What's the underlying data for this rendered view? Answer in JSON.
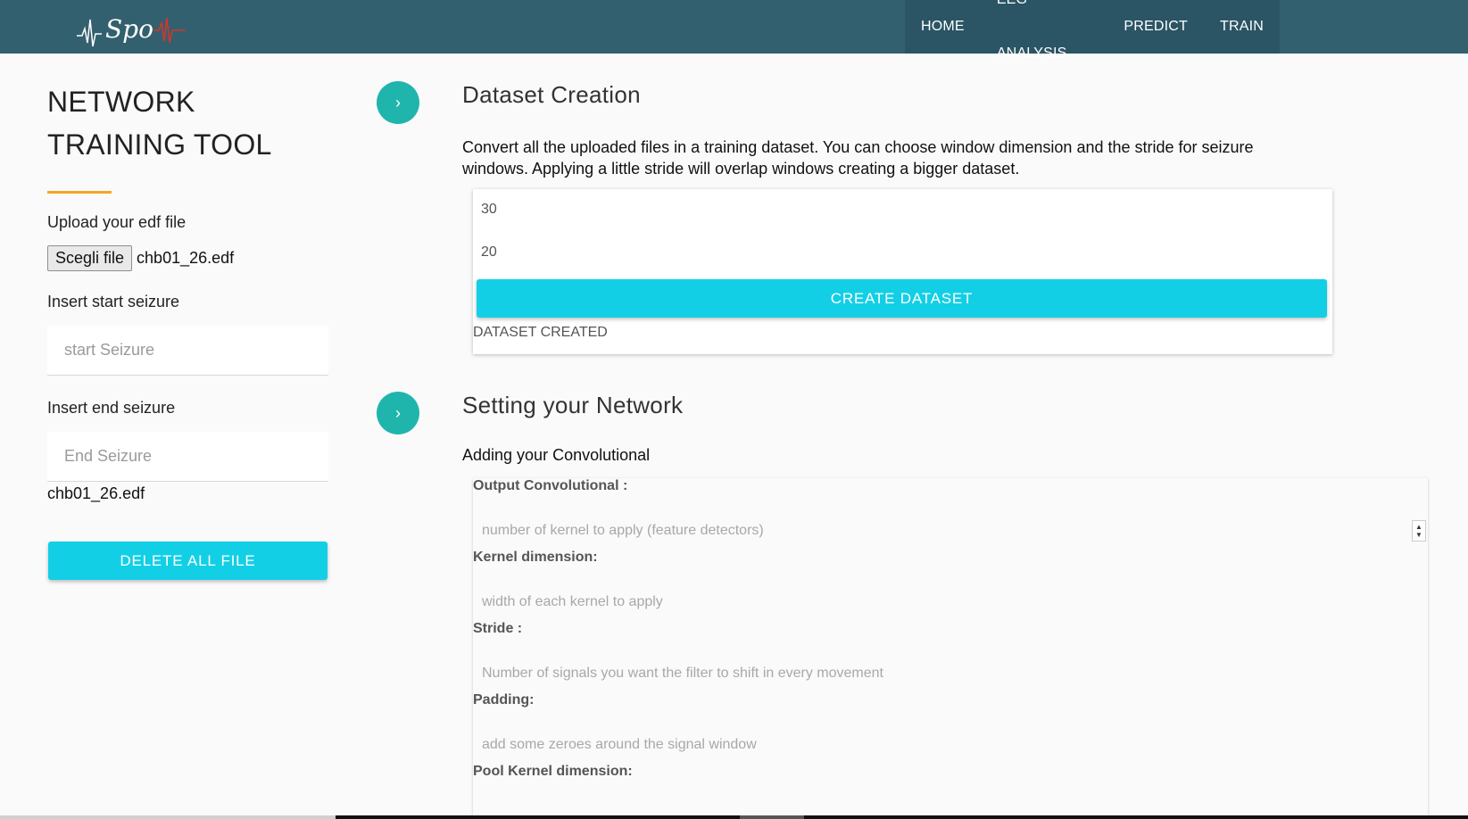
{
  "header": {
    "logo_text": "Spo",
    "nav": [
      "HOME",
      "EEG ANALYSIS",
      "PREDICT",
      "TRAIN"
    ]
  },
  "sidebar": {
    "title_line1": "NETWORK",
    "title_line2": "TRAINING TOOL",
    "upload_label": "Upload your edf file",
    "choose_file_button": "Scegli file",
    "chosen_file": "chb01_26.edf",
    "start_label": "Insert start seizure",
    "start_placeholder": "start Seizure",
    "end_label": "Insert end seizure",
    "end_placeholder": "End Seizure",
    "uploaded_file": "chb01_26.edf",
    "delete_button": "DELETE ALL FILE"
  },
  "dataset": {
    "title": "Dataset Creation",
    "description": "Convert all the uploaded files in a training dataset. You can choose window dimension and the stride for seizure windows. Applying a little stride will overlap windows creating a bigger dataset.",
    "window_value": "30",
    "stride_value": "20",
    "create_button": "CREATE DATASET",
    "status": "DATASET CREATED"
  },
  "network": {
    "title": "Setting your Network",
    "subtitle": "Adding your Convolutional",
    "fields": [
      {
        "label": "Output Convolutional :",
        "placeholder": "number of kernel to apply (feature detectors)"
      },
      {
        "label": "Kernel dimension:",
        "placeholder": "width of each kernel to apply"
      },
      {
        "label": "Stride :",
        "placeholder": "Number of signals you want the filter to shift in every movement"
      },
      {
        "label": "Padding:",
        "placeholder": "add some zeroes around the signal window"
      },
      {
        "label": "Pool Kernel dimension:",
        "placeholder": ""
      }
    ]
  },
  "icons": {
    "step_arrow": "›",
    "spinner_up": "▲",
    "spinner_down": "▼"
  },
  "colors": {
    "topbar": "#33606e",
    "accent_button": "#12cfe6",
    "step_circle": "#1fb5ad",
    "title_underline": "#f5a623"
  }
}
